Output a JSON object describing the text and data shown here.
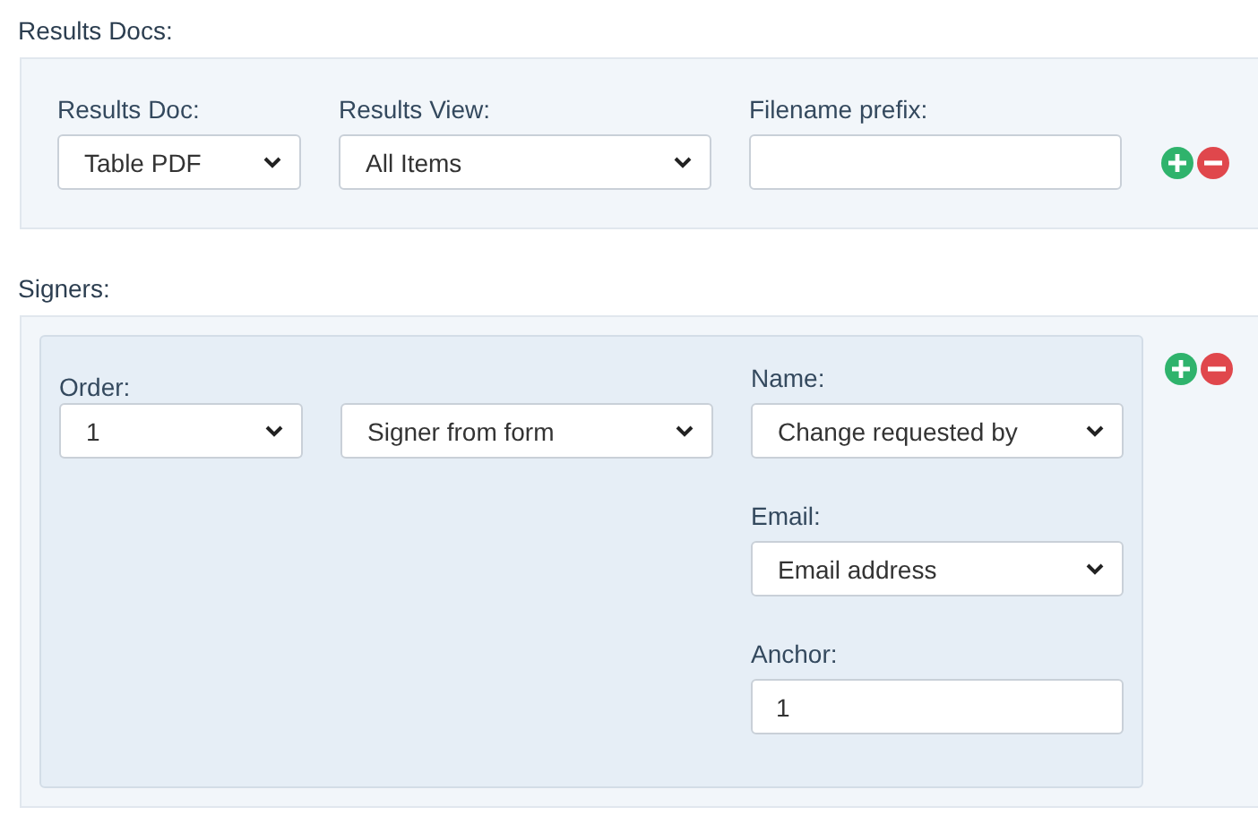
{
  "results_docs": {
    "title": "Results Docs:",
    "fields": [
      {
        "label": "Results Doc:",
        "kind": "select",
        "value": "Table PDF"
      },
      {
        "label": "Results View:",
        "kind": "select",
        "value": "All Items"
      },
      {
        "label": "Filename prefix:",
        "kind": "text"
      }
    ]
  },
  "signers": {
    "title": "Signers:",
    "items": [
      {
        "columns": [
          [
            {
              "label": "Order:",
              "kind": "select",
              "value": "1"
            }
          ],
          [
            {
              "kind": "select",
              "value": "Signer from form"
            }
          ],
          [
            {
              "label": "Name:",
              "kind": "select",
              "value": "Change requested by"
            },
            {
              "label": "Email:",
              "kind": "select",
              "value": "Email address"
            },
            {
              "label": "Anchor:",
              "kind": "text",
              "value": "1"
            }
          ]
        ]
      }
    ]
  }
}
